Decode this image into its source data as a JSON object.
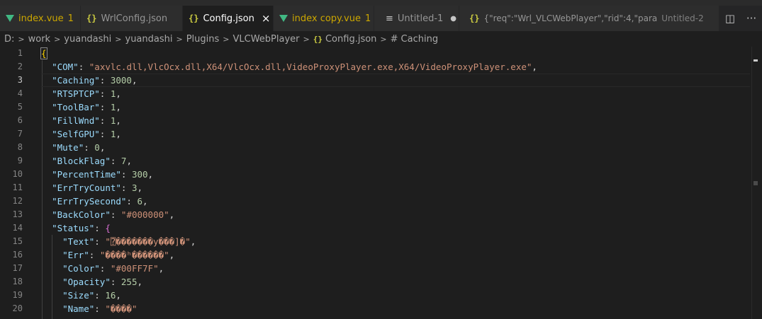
{
  "tabs": [
    {
      "label": "index.vue",
      "type": "vue",
      "badge": "1",
      "active": false
    },
    {
      "label": "WrlConfig.json",
      "type": "json",
      "active": false
    },
    {
      "label": "Config.json",
      "type": "json",
      "active": true,
      "close": "×"
    },
    {
      "label": "index copy.vue",
      "type": "vue",
      "badge": "1",
      "active": false
    },
    {
      "label": "Untitled-1",
      "type": "text",
      "dirty": "●",
      "active": false
    },
    {
      "label": "{\"req\":\"Wrl_VLCWebPlayer\",\"rid\":4,\"para",
      "type": "json",
      "desc": "Untitled-2",
      "active": false
    }
  ],
  "tab_actions": {
    "split": "split-editor-icon",
    "more": "···"
  },
  "breadcrumb": [
    "D:",
    "work",
    "yuandashi",
    "yuandashi",
    "Plugins",
    "VLCWebPlayer",
    "Config.json",
    "Caching"
  ],
  "editor": {
    "current_line": 3,
    "line_numbers": [
      "1",
      "2",
      "3",
      "4",
      "5",
      "6",
      "7",
      "8",
      "9",
      "10",
      "11",
      "12",
      "13",
      "14",
      "15",
      "16",
      "17",
      "18",
      "19",
      "20"
    ],
    "lines": [
      {
        "indent": "",
        "open": "{"
      },
      {
        "indent": "  ",
        "key": "\"COM\"",
        "sep": ": ",
        "str": "\"axvlc.dll,VlcOcx.dll,X64/VlcOcx.dll,VideoProxyPlayer.exe,X64/VideoProxyPlayer.exe\"",
        "end": ","
      },
      {
        "indent": "  ",
        "key": "\"Caching\"",
        "sep": ": ",
        "num": "3000",
        "end": ","
      },
      {
        "indent": "  ",
        "key": "\"RTSPTCP\"",
        "sep": ": ",
        "num": "1",
        "end": ","
      },
      {
        "indent": "  ",
        "key": "\"ToolBar\"",
        "sep": ": ",
        "num": "1",
        "end": ","
      },
      {
        "indent": "  ",
        "key": "\"FillWnd\"",
        "sep": ": ",
        "num": "1",
        "end": ","
      },
      {
        "indent": "  ",
        "key": "\"SelfGPU\"",
        "sep": ": ",
        "num": "1",
        "end": ","
      },
      {
        "indent": "  ",
        "key": "\"Mute\"",
        "sep": ": ",
        "num": "0",
        "end": ","
      },
      {
        "indent": "  ",
        "key": "\"BlockFlag\"",
        "sep": ": ",
        "num": "7",
        "end": ","
      },
      {
        "indent": "  ",
        "key": "\"PercentTime\"",
        "sep": ": ",
        "num": "300",
        "end": ","
      },
      {
        "indent": "  ",
        "key": "\"ErrTryCount\"",
        "sep": ": ",
        "num": "3",
        "end": ","
      },
      {
        "indent": "  ",
        "key": "\"ErrTrySecond\"",
        "sep": ": ",
        "num": "6",
        "end": ","
      },
      {
        "indent": "  ",
        "key": "\"BackColor\"",
        "sep": ": ",
        "str": "\"#000000\"",
        "end": ","
      },
      {
        "indent": "  ",
        "key": "\"Status\"",
        "sep": ": ",
        "brace": "{"
      },
      {
        "indent": "    ",
        "key": "\"Text\"",
        "sep": ": ",
        "str": "\"⍰�������у���]�\"",
        "end": ","
      },
      {
        "indent": "    ",
        "key": "\"Err\"",
        "sep": ": ",
        "str": "\"����ʰ������\"",
        "end": ","
      },
      {
        "indent": "    ",
        "key": "\"Color\"",
        "sep": ": ",
        "str": "\"#00FF7F\"",
        "end": ","
      },
      {
        "indent": "    ",
        "key": "\"Opacity\"",
        "sep": ": ",
        "num": "255",
        "end": ","
      },
      {
        "indent": "    ",
        "key": "\"Size\"",
        "sep": ": ",
        "num": "16",
        "end": ","
      },
      {
        "indent": "    ",
        "key": "\"Name\"",
        "sep": ": ",
        "str": "\"����\"",
        "end": ""
      }
    ]
  }
}
